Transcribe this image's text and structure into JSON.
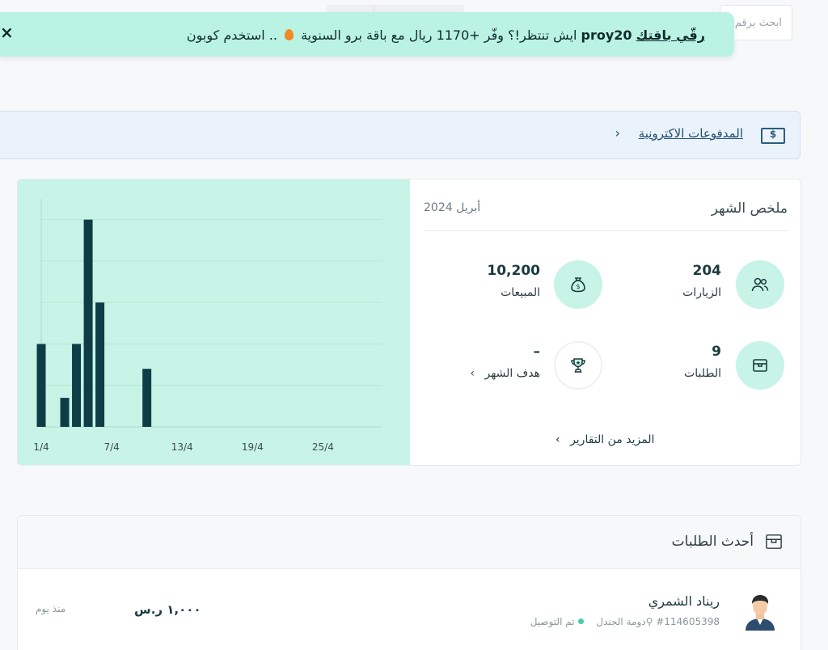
{
  "topbar": {
    "search_placeholder": "ابحث برقم الطلب"
  },
  "promo": {
    "link_text": "رقّي باقتك",
    "text_a": " ",
    "code": "proy20",
    "text_b": " ايش تنتظر!؟ وفّر +1170 ريال مع باقة برو السنوية ",
    "text_c": " .. استخدم كوبون",
    "close_label": "×"
  },
  "payments": {
    "label": "المدفوعات الاكترونية",
    "chevron": "›"
  },
  "summary": {
    "title": "ملخص الشهر",
    "month": "أبريل 2024",
    "stats": {
      "visits": {
        "value": "204",
        "label": "الزيارات"
      },
      "sales": {
        "value": "10,200",
        "label": "المبيعات"
      },
      "orders": {
        "value": "9",
        "label": "الطلبات"
      },
      "goal": {
        "value": "–",
        "label": "هدف الشهر",
        "chevron": "›"
      }
    },
    "more_reports": "المزيد من التقارير",
    "more_chevron": "›"
  },
  "chart_data": {
    "type": "bar",
    "x": [
      1,
      3,
      4,
      5,
      6,
      10
    ],
    "values": [
      2,
      0.7,
      2,
      5,
      3,
      1.4
    ],
    "x_range": [
      1,
      30
    ],
    "tick_labels": [
      "1/4",
      "7/4",
      "13/4",
      "19/4",
      "25/4"
    ],
    "tick_positions": [
      1,
      7,
      13,
      19,
      25
    ],
    "ylim": [
      0,
      5.5
    ],
    "grid": true,
    "bar_color": "#0e3d47",
    "title": "",
    "xlabel": "",
    "ylabel": ""
  },
  "orders": {
    "title": "أحدث الطلبات",
    "items": [
      {
        "name": "ريناد الشمري",
        "id": "#114605398",
        "location": "دومة الجندل",
        "status": "تم التوصيل",
        "amount": "١,٠٠٠ ر.س",
        "time": "منذ يوم"
      }
    ]
  },
  "colors": {
    "mint": "#c7f4e6",
    "promo": "#baf3e3",
    "dark": "#0e3d47"
  }
}
